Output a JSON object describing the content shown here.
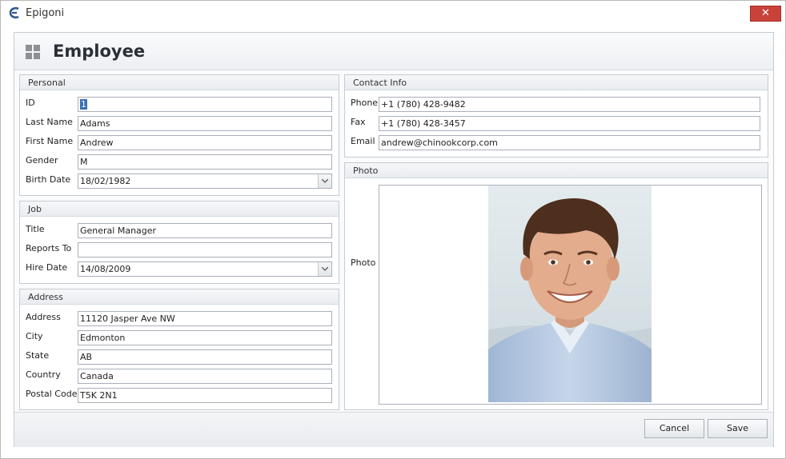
{
  "window": {
    "title": "Epigoni",
    "close_label": "✕"
  },
  "header": {
    "title": "Employee"
  },
  "personal": {
    "title": "Personal",
    "id_label": "ID",
    "id_value": "1",
    "last_name_label": "Last Name",
    "last_name_value": "Adams",
    "first_name_label": "First Name",
    "first_name_value": "Andrew",
    "gender_label": "Gender",
    "gender_value": "M",
    "birth_date_label": "Birth Date",
    "birth_date_value": "18/02/1982"
  },
  "job": {
    "title": "Job",
    "title_label": "Title",
    "title_value": "General Manager",
    "reports_to_label": "Reports To",
    "reports_to_value": "",
    "hire_date_label": "Hire Date",
    "hire_date_value": "14/08/2009"
  },
  "address": {
    "title": "Address",
    "address_label": "Address",
    "address_value": "11120 Jasper Ave NW",
    "city_label": "City",
    "city_value": "Edmonton",
    "state_label": "State",
    "state_value": "AB",
    "country_label": "Country",
    "country_value": "Canada",
    "postal_code_label": "Postal Code",
    "postal_code_value": "T5K 2N1"
  },
  "contact": {
    "title": "Contact Info",
    "phone_label": "Phone",
    "phone_value": "+1 (780) 428-9482",
    "fax_label": "Fax",
    "fax_value": "+1 (780) 428-3457",
    "email_label": "Email",
    "email_value": "andrew@chinookcorp.com"
  },
  "photo": {
    "title": "Photo",
    "label": "Photo"
  },
  "footer": {
    "cancel_label": "Cancel",
    "save_label": "Save"
  },
  "colors": {
    "close_button": "#c9423a",
    "selection": "#3a6fb5",
    "border": "#a9b0ba"
  }
}
